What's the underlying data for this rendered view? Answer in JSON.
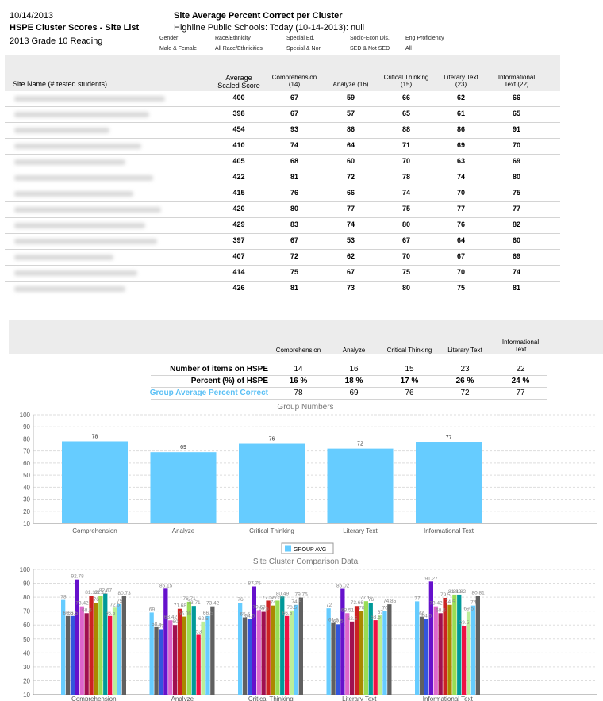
{
  "header": {
    "date": "10/14/2013",
    "title": "HSPE Cluster Scores - Site List",
    "subtitle": "2013 Grade 10 Reading",
    "main_title": "Site Average Percent Correct per Cluster",
    "main_subtitle": "Highline Public Schools: Today (10-14-2013): null"
  },
  "filters": [
    {
      "label": "Gender",
      "value": "Male & Female"
    },
    {
      "label": "Race/Ethnicity",
      "value": "All Race/Ethnicities"
    },
    {
      "label": "Special Ed.",
      "value": "Special & Non"
    },
    {
      "label": "Socio-Econ Dis.",
      "value": "SED & Not SED"
    },
    {
      "label": "Eng Proficiency",
      "value": "All"
    }
  ],
  "site_table": {
    "site_header": "Site Name (# tested students)",
    "score_header_1": "Average",
    "score_header_2": "Scaled Score",
    "cluster_headers": [
      {
        "l1": "Comprehension",
        "l2": "(14)"
      },
      {
        "l1": "Analyze (16)",
        "l2": ""
      },
      {
        "l1": "Critical Thinking",
        "l2": "(15)"
      },
      {
        "l1": "Literary Text",
        "l2": "(23)"
      },
      {
        "l1": "Informational",
        "l2": "Text (22)"
      }
    ],
    "rows": [
      [
        "400",
        "67",
        "59",
        "66",
        "62",
        "66"
      ],
      [
        "398",
        "67",
        "57",
        "65",
        "61",
        "65"
      ],
      [
        "454",
        "93",
        "86",
        "88",
        "86",
        "91"
      ],
      [
        "410",
        "74",
        "64",
        "71",
        "69",
        "70"
      ],
      [
        "405",
        "68",
        "60",
        "70",
        "63",
        "69"
      ],
      [
        "422",
        "81",
        "72",
        "78",
        "74",
        "80"
      ],
      [
        "415",
        "76",
        "66",
        "74",
        "70",
        "75"
      ],
      [
        "420",
        "80",
        "77",
        "75",
        "77",
        "77"
      ],
      [
        "429",
        "83",
        "74",
        "80",
        "76",
        "82"
      ],
      [
        "397",
        "67",
        "53",
        "67",
        "64",
        "60"
      ],
      [
        "407",
        "72",
        "62",
        "70",
        "67",
        "69"
      ],
      [
        "414",
        "75",
        "67",
        "75",
        "70",
        "74"
      ],
      [
        "426",
        "81",
        "73",
        "80",
        "75",
        "81"
      ]
    ]
  },
  "summary": {
    "headers": [
      {
        "l1": "Comprehension",
        "l2": ""
      },
      {
        "l1": "Analyze",
        "l2": ""
      },
      {
        "l1": "Critical Thinking",
        "l2": ""
      },
      {
        "l1": "Literary Text",
        "l2": ""
      },
      {
        "l1": "Informational",
        "l2": "Text"
      }
    ],
    "rows": [
      {
        "label": "Number of items on HSPE",
        "values": [
          "14",
          "16",
          "15",
          "23",
          "22"
        ],
        "bold": false
      },
      {
        "label": "Percent (%) of HSPE",
        "values": [
          "16 %",
          "18 %",
          "17 %",
          "26 %",
          "24 %"
        ],
        "bold": true
      },
      {
        "label": "Group Average Percent Correct",
        "values": [
          "78",
          "69",
          "76",
          "72",
          "77"
        ],
        "bold": false,
        "color": "#5bc0f5"
      }
    ]
  },
  "colors": {
    "group_avg": "#66ccff",
    "site_palette": [
      "#606060",
      "#3355dd",
      "#6611cc",
      "#dd66cc",
      "#a01050",
      "#cc2222",
      "#aa8800",
      "#99dd55",
      "#009999",
      "#ee1144",
      "#bbee99"
    ]
  },
  "chart_data": [
    {
      "type": "bar",
      "title": "Group Numbers",
      "categories": [
        "Comprehension",
        "Analyze",
        "Critical Thinking",
        "Literary Text",
        "Informational Text"
      ],
      "values": [
        78,
        69,
        76,
        72,
        77
      ],
      "ylim": [
        10,
        100
      ],
      "yticks": [
        10,
        20,
        30,
        40,
        50,
        60,
        70,
        80,
        90,
        100
      ],
      "grid": true,
      "legend": {
        "label": "GROUP AVG",
        "placement": "bottom-center"
      }
    },
    {
      "type": "bar",
      "title": "Site Cluster Comparison Data",
      "categories": [
        "Comprehension",
        "Analyze",
        "Critical Thinking",
        "Literary Text",
        "Informational Text"
      ],
      "ylim": [
        10,
        100
      ],
      "yticks": [
        10,
        20,
        30,
        40,
        50,
        60,
        70,
        80,
        90,
        100
      ],
      "grid": true,
      "series": [
        {
          "name": "GROUP AVG",
          "values": [
            78,
            69,
            76,
            72,
            77
          ]
        },
        {
          "values": [
            66.5,
            58.5,
            65.5,
            61.5,
            66
          ]
        },
        {
          "values": [
            66.5,
            57,
            64.5,
            60.5,
            64.5
          ]
        },
        {
          "values": [
            92.78,
            86.15,
            87.75,
            86.02,
            91.27
          ]
        },
        {
          "values": [
            73.42,
            63.42,
            70.68,
            68.51,
            73.42
          ]
        },
        {
          "values": [
            68.5,
            60,
            69.5,
            62.5,
            68.5
          ]
        },
        {
          "values": [
            81.12,
            71.68,
            77.52,
            73.66,
            79.5
          ]
        },
        {
          "values": [
            76,
            66.06,
            74,
            70,
            74.5
          ]
        },
        {
          "values": [
            81.12,
            76.71,
            77.52,
            77.11,
            81.82
          ]
        },
        {
          "values": [
            82.67,
            73.71,
            80.49,
            76,
            81.82
          ]
        },
        {
          "values": [
            66.5,
            53,
            66.5,
            63.5,
            59.5
          ]
        },
        {
          "values": [
            72.5,
            62.5,
            70.5,
            67,
            69.5
          ]
        },
        {
          "values": [
            75,
            66.5,
            74.5,
            70,
            74
          ]
        },
        {
          "values": [
            80.73,
            73.42,
            79.75,
            74.85,
            80.81
          ]
        }
      ],
      "value_labels": [
        [
          "78",
          "66.5",
          "66.5",
          "92.78",
          "73.42",
          "68.5",
          "81.12",
          "76",
          "81.12",
          "82.67",
          "66.5",
          "72.5",
          "75",
          "80.73"
        ],
        [
          "69",
          "58.5",
          "57",
          "86.15",
          "63.42",
          "60",
          "71.68",
          "66.06",
          "76.71",
          "73.71",
          "53",
          "62.5",
          "66.5",
          "73.42"
        ],
        [
          "76",
          "65.5",
          "64.5",
          "87.75",
          "70.68",
          "69.5",
          "77.52",
          "74",
          "77.52",
          "80.49",
          "66.5",
          "70.5",
          "74.5",
          "79.75"
        ],
        [
          "72",
          "61.5",
          "60.5",
          "86.02",
          "68.51",
          "62.5",
          "73.66",
          "70",
          "77.11",
          "76",
          "63.5",
          "67",
          "70",
          "74.85"
        ],
        [
          "77",
          "66",
          "64.5",
          "91.27",
          "73.42",
          "68.5",
          "79.5",
          "74.5",
          "81.82",
          "81.82",
          "59.5",
          "69.5",
          "74",
          "80.81"
        ]
      ]
    }
  ]
}
